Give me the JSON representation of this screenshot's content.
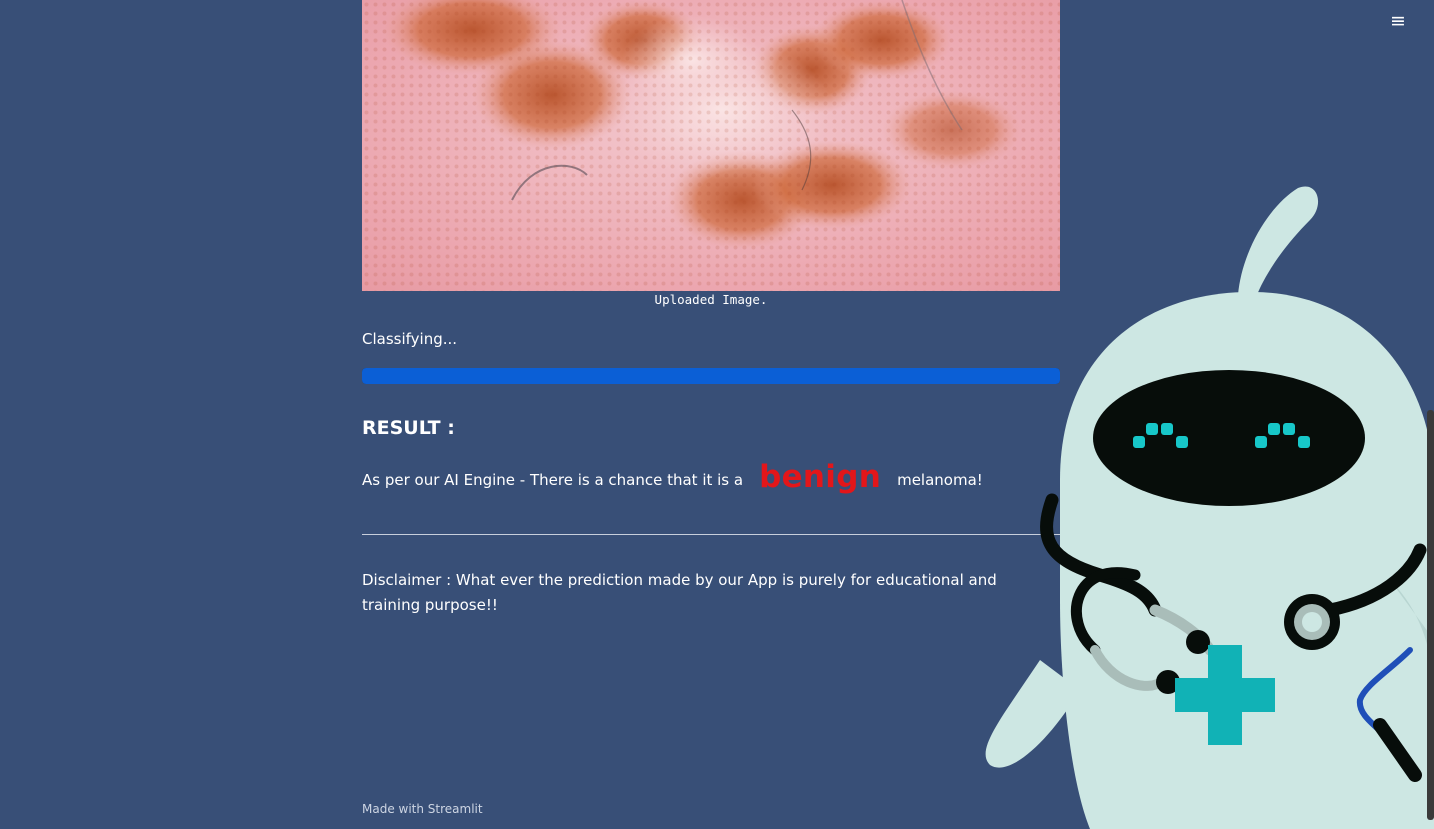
{
  "header": {
    "menu_icon": "hamburger-menu-icon",
    "menu_glyph": "≡"
  },
  "image": {
    "caption": "Uploaded Image."
  },
  "status": {
    "classifying_text": "Classifying...",
    "progress_percent": 100,
    "progress_color": "#0b5fd6"
  },
  "result": {
    "heading": "RESULT :",
    "prefix": "As per our AI Engine - There is a chance that it is a",
    "verdict": "benign",
    "verdict_color": "#e3161a",
    "suffix": "melanoma!"
  },
  "disclaimer": {
    "text": "Disclaimer : What ever the prediction made by our App is purely for educational and training purpose!!"
  },
  "footer": {
    "made_with": "Made with Streamlit"
  },
  "colors": {
    "background": "#384f77",
    "text": "#ffffff"
  },
  "decor": {
    "mascot": "doctor-robot-mascot"
  }
}
